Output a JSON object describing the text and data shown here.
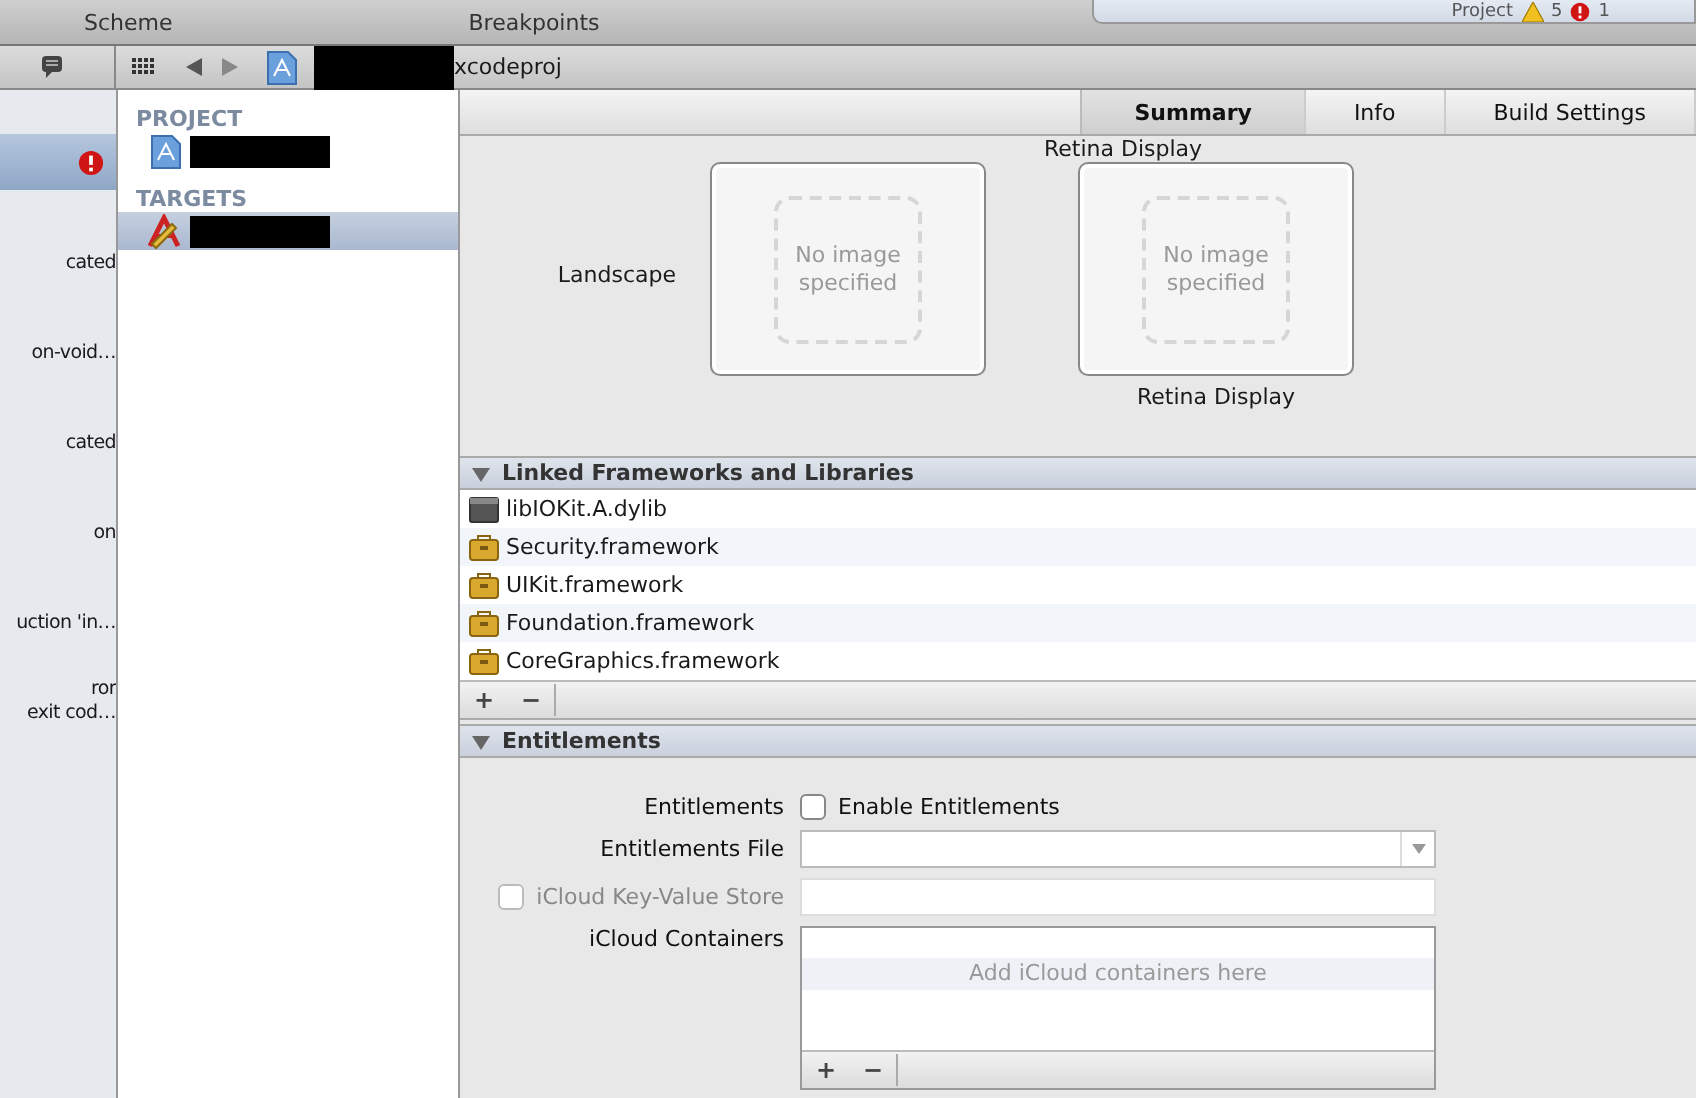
{
  "toolbar": {
    "scheme_label": "Scheme",
    "breakpoints_label": "Breakpoints",
    "activity": {
      "label": "Project",
      "warnings": "5",
      "errors": "1"
    }
  },
  "jump_bar": {
    "path_suffix": "xcodeproj"
  },
  "issue_navigator": {
    "items": [
      {
        "selected": true,
        "error": true
      },
      {
        "lines": [
          "cated"
        ],
        "selected": false,
        "error": false
      },
      {
        "lines": [
          "on-void…"
        ],
        "selected": false,
        "error": false
      },
      {
        "lines": [
          "cated"
        ],
        "selected": false,
        "error": false
      },
      {
        "lines": [
          "on"
        ],
        "selected": false,
        "error": false
      },
      {
        "lines": [
          "uction 'in…"
        ],
        "selected": false,
        "error": false
      },
      {
        "lines": [
          "ror",
          "exit cod…"
        ],
        "selected": false,
        "error": false
      }
    ]
  },
  "project_list": {
    "sections": [
      {
        "title": "PROJECT",
        "items": [
          {
            "kind": "project",
            "selected": false
          }
        ]
      },
      {
        "title": "TARGETS",
        "items": [
          {
            "kind": "app",
            "selected": true
          }
        ]
      }
    ]
  },
  "tabs": [
    {
      "label": "Summary",
      "selected": true
    },
    {
      "label": "Info",
      "selected": false
    },
    {
      "label": "Build Settings",
      "selected": false
    }
  ],
  "launch_images": {
    "top_label": "Retina Display",
    "row_label": "Landscape",
    "wells": [
      {
        "placeholder": "No image specified"
      },
      {
        "placeholder": "No image specified",
        "caption": "Retina Display"
      }
    ]
  },
  "frameworks": {
    "title": "Linked Frameworks and Libraries",
    "expanded": true,
    "items": [
      {
        "name": "libIOKit.A.dylib",
        "kind": "dylib"
      },
      {
        "name": "Security.framework",
        "kind": "framework"
      },
      {
        "name": "UIKit.framework",
        "kind": "framework"
      },
      {
        "name": "Foundation.framework",
        "kind": "framework"
      },
      {
        "name": "CoreGraphics.framework",
        "kind": "framework"
      }
    ],
    "add": "+",
    "remove": "−"
  },
  "entitlements": {
    "title": "Entitlements",
    "expanded": true,
    "enable": {
      "label": "Entitlements",
      "checkbox_label": "Enable Entitlements",
      "checked": false
    },
    "file": {
      "label": "Entitlements File"
    },
    "kvstore": {
      "label": "iCloud Key-Value Store",
      "checked": false,
      "disabled": true
    },
    "containers": {
      "label": "iCloud Containers",
      "placeholder": "Add iCloud containers here",
      "add": "+",
      "remove": "−"
    }
  }
}
